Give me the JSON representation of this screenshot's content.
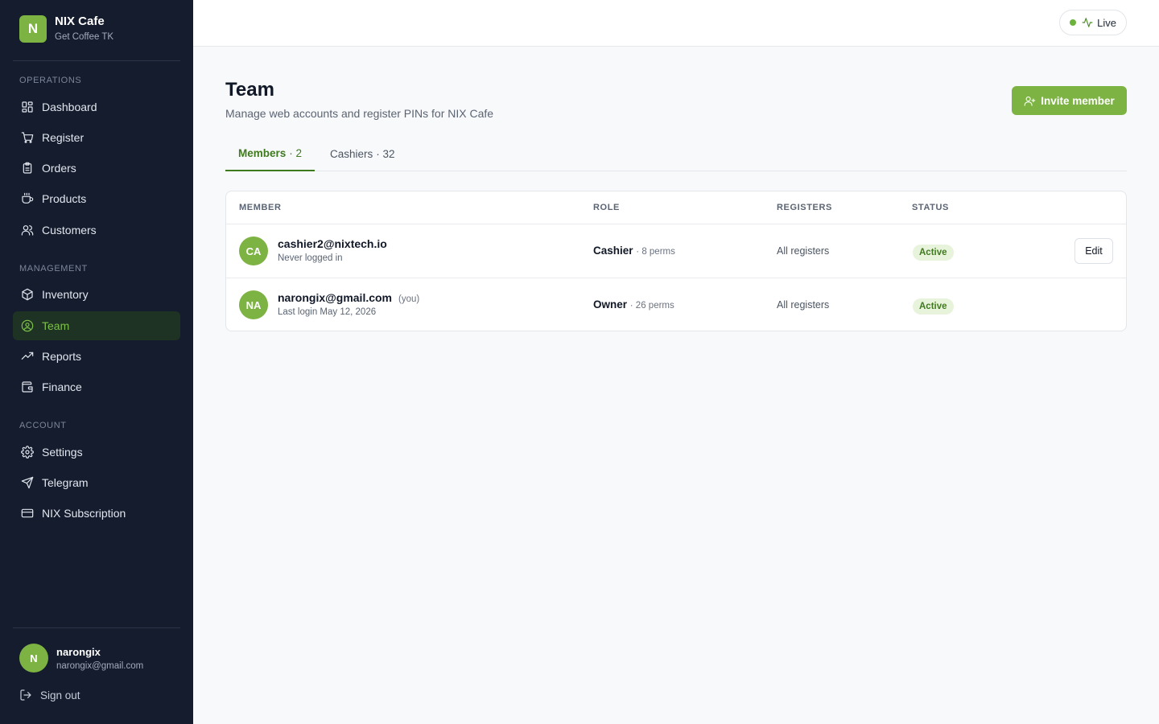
{
  "brand": {
    "logo_letter": "N",
    "name": "NIX Cafe",
    "subtitle": "Get Coffee TK"
  },
  "sidebar": {
    "sections": [
      {
        "label": "OPERATIONS",
        "items": [
          "Dashboard",
          "Register",
          "Orders",
          "Products",
          "Customers"
        ]
      },
      {
        "label": "MANAGEMENT",
        "items": [
          "Inventory",
          "Team",
          "Reports",
          "Finance"
        ]
      },
      {
        "label": "ACCOUNT",
        "items": [
          "Settings",
          "Telegram",
          "NIX Subscription"
        ]
      }
    ],
    "active_item": "Team"
  },
  "nav": {
    "operations_label": "OPERATIONS",
    "dashboard": "Dashboard",
    "register": "Register",
    "orders": "Orders",
    "products": "Products",
    "customers": "Customers",
    "management_label": "MANAGEMENT",
    "inventory": "Inventory",
    "team": "Team",
    "reports": "Reports",
    "finance": "Finance",
    "account_label": "ACCOUNT",
    "settings": "Settings",
    "telegram": "Telegram",
    "subscription": "NIX Subscription"
  },
  "user": {
    "initial": "N",
    "name": "narongix",
    "email": "narongix@gmail.com",
    "signout_label": "Sign out"
  },
  "header": {
    "live_label": "Live"
  },
  "page": {
    "title": "Team",
    "subtitle": "Manage web accounts and register PINs for NIX Cafe",
    "invite_label": "Invite member"
  },
  "tabs": [
    {
      "label": "Members",
      "count": "· 2",
      "active": true
    },
    {
      "label": "Cashiers",
      "count": "· 32",
      "active": false
    }
  ],
  "table": {
    "columns": [
      "MEMBER",
      "ROLE",
      "REGISTERS",
      "STATUS"
    ],
    "rows": [
      {
        "initials": "CA",
        "email": "cashier2@nixtech.io",
        "you": "",
        "login": "Never logged in",
        "role": "Cashier",
        "perms": "· 8 perms",
        "registers": "All registers",
        "status": "Active",
        "action": "Edit"
      },
      {
        "initials": "NA",
        "email": "narongix@gmail.com",
        "you": "(you)",
        "login": "Last login May 12, 2026",
        "role": "Owner",
        "perms": "· 26 perms",
        "registers": "All registers",
        "status": "Active",
        "action": ""
      }
    ]
  },
  "colors": {
    "sidebar_bg": "#141c2e",
    "accent": "#7cb342",
    "active_text": "#3f7a1e",
    "badge_bg": "#e8f3dc"
  }
}
